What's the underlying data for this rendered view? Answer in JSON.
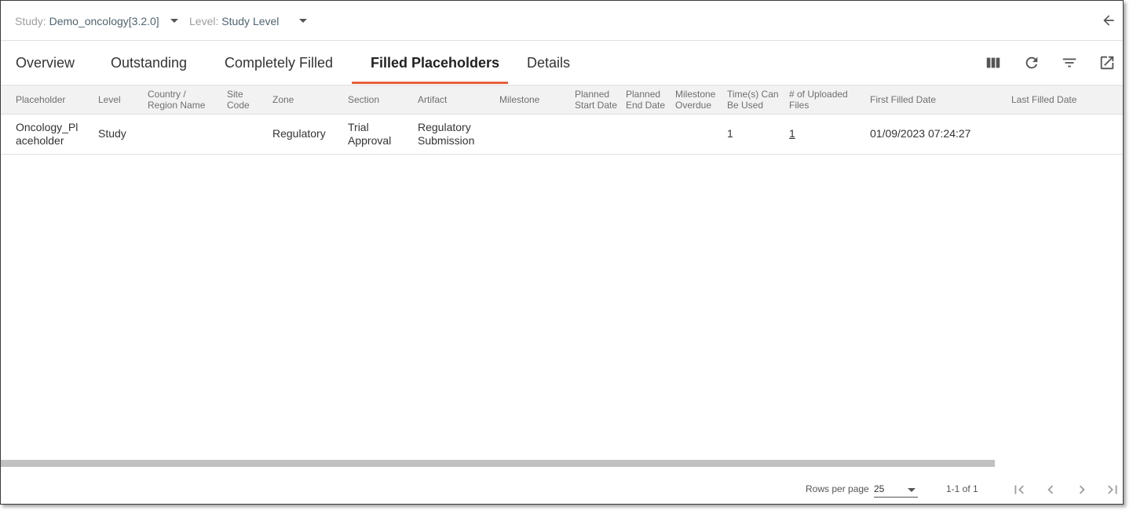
{
  "header": {
    "study_label": "Study:",
    "study_value": "Demo_oncology[3.2.0]",
    "level_label": "Level:",
    "level_value": "Study Level"
  },
  "tabs": [
    {
      "label": "Overview"
    },
    {
      "label": "Outstanding"
    },
    {
      "label": "Completely Filled"
    },
    {
      "label": "Filled Placeholders",
      "active": true
    },
    {
      "label": "Details"
    }
  ],
  "toolbar_icons": [
    "columns-icon",
    "refresh-icon",
    "filter-icon",
    "open-external-icon"
  ],
  "table": {
    "columns": [
      {
        "line1": "Placeholder",
        "line2": ""
      },
      {
        "line1": "Level",
        "line2": ""
      },
      {
        "line1": "Country /",
        "line2": "Region Name"
      },
      {
        "line1": "Site",
        "line2": "Code"
      },
      {
        "line1": "Zone",
        "line2": ""
      },
      {
        "line1": "Section",
        "line2": ""
      },
      {
        "line1": "Artifact",
        "line2": ""
      },
      {
        "line1": "Milestone",
        "line2": ""
      },
      {
        "line1": "Planned",
        "line2": "Start Date"
      },
      {
        "line1": "Planned",
        "line2": "End Date"
      },
      {
        "line1": "Milestone",
        "line2": "Overdue"
      },
      {
        "line1": "Time(s) Can",
        "line2": "Be Used"
      },
      {
        "line1": "# of Uploaded",
        "line2": "Files"
      },
      {
        "line1": "First Filled Date",
        "line2": ""
      },
      {
        "line1": "Last Filled Date",
        "line2": ""
      }
    ],
    "rows": [
      {
        "placeholder_l1": "Oncology_Pl",
        "placeholder_l2": "aceholder",
        "level": "Study",
        "zone": "Regulatory",
        "section_l1": "Trial",
        "section_l2": "Approval",
        "artifact_l1": "Regulatory",
        "artifact_l2": "Submission",
        "times_can_be_used": "1",
        "uploaded_files": "1",
        "first_filled_date": "01/09/2023 07:24:27",
        "last_filled_date": ""
      }
    ]
  },
  "footer": {
    "rows_per_page_label": "Rows per page",
    "rows_per_page_value": "25",
    "range_text": "1-1 of 1"
  },
  "colors": {
    "accent": "#e8603c",
    "header_bg": "#f2f2f2",
    "selector_value": "#4f6470"
  }
}
